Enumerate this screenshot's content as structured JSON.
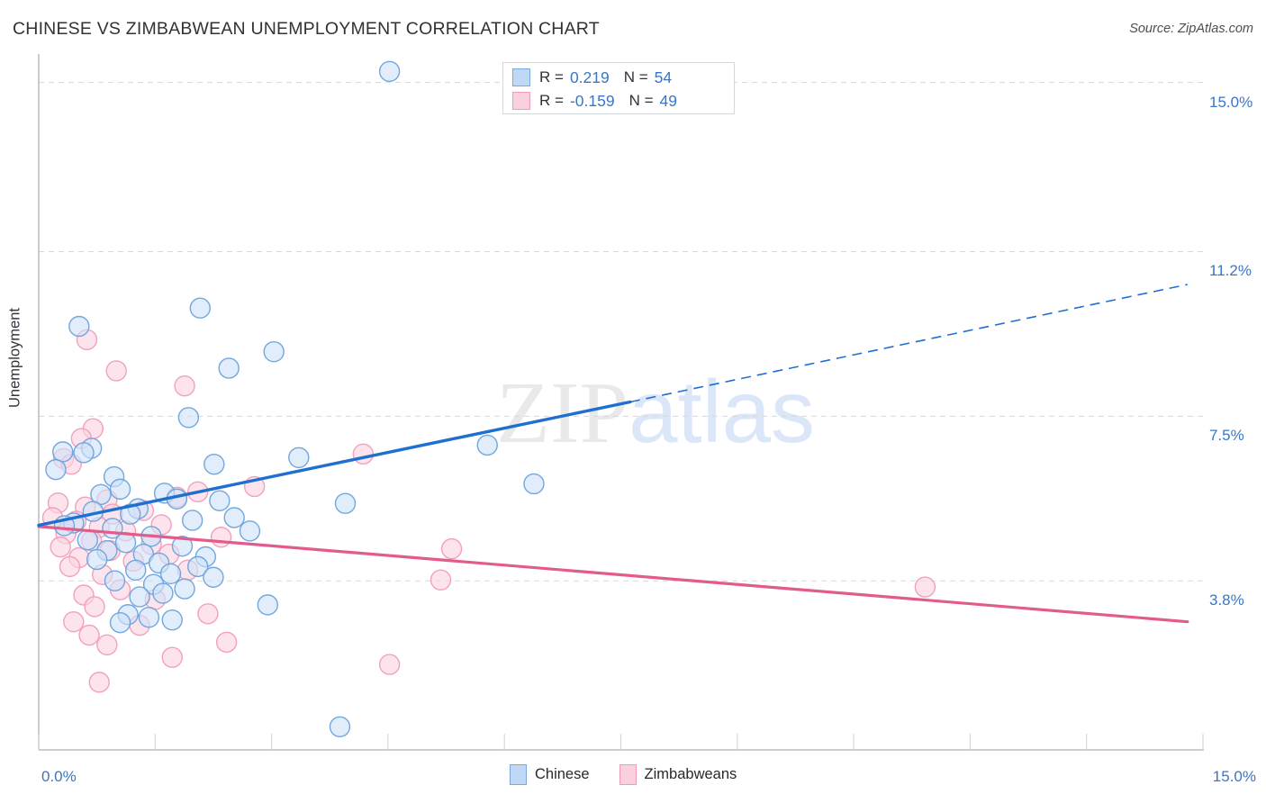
{
  "header": {
    "title": "CHINESE VS ZIMBABWEAN UNEMPLOYMENT CORRELATION CHART",
    "source": "Source: ZipAtlas.com"
  },
  "watermark": {
    "part1": "ZIP",
    "part2": "atlas"
  },
  "stats": {
    "series1": {
      "r_key": "R =",
      "r_value": "0.219",
      "n_key": "N =",
      "n_value": "54"
    },
    "series2": {
      "r_key": "R =",
      "r_value": "-0.159",
      "n_key": "N =",
      "n_value": "49"
    }
  },
  "legend": {
    "items": [
      {
        "label": "Chinese",
        "color": "#bed8f5"
      },
      {
        "label": "Zimbabweans",
        "color": "#fbd0de"
      }
    ]
  },
  "colors": {
    "blue_fill": "#cfe2f8",
    "blue_stroke": "#6aa2db",
    "pink_fill": "#fbd4e1",
    "pink_stroke": "#f09cba",
    "blue_line": "#1f6fd0",
    "pink_line": "#e35a8c",
    "tick_text": "#3a76c4",
    "grid": "#d8d8d8"
  },
  "chart_data": {
    "type": "scatter",
    "title": "CHINESE VS ZIMBABWEAN UNEMPLOYMENT CORRELATION CHART",
    "xlabel": "",
    "ylabel": "Unemployment",
    "xlim": [
      0.0,
      15.0
    ],
    "ylim": [
      0.0,
      15.6
    ],
    "grid": true,
    "legend_position": "bottom-center",
    "xticks": [
      "0.0%",
      "15.0%"
    ],
    "xtick_values": [
      0.0,
      15.0
    ],
    "yticks": [
      "3.8%",
      "7.5%",
      "11.2%",
      "15.0%"
    ],
    "ytick_values": [
      3.8,
      7.5,
      11.2,
      15.0
    ],
    "annotations": [
      {
        "series": "Chinese",
        "R": 0.219,
        "N": 54
      },
      {
        "series": "Zimbabweans",
        "R": -0.159,
        "N": 49
      }
    ],
    "series": [
      {
        "name": "Chinese",
        "color": "#cfe2f8",
        "stroke": "#6aa2db",
        "R": 0.219,
        "N": 54,
        "trendline": {
          "x0": 0.0,
          "y0": 5.05,
          "x1": 7.62,
          "y1": 7.82,
          "x2": 14.8,
          "y2": 10.46,
          "solid_to_x": 7.62,
          "dashed_from_x": 7.62
        },
        "points": [
          [
            4.52,
            15.25
          ],
          [
            2.08,
            9.93
          ],
          [
            0.52,
            9.52
          ],
          [
            3.03,
            8.95
          ],
          [
            2.45,
            8.58
          ],
          [
            1.93,
            7.47
          ],
          [
            0.68,
            6.78
          ],
          [
            0.31,
            6.7
          ],
          [
            0.58,
            6.68
          ],
          [
            5.78,
            6.85
          ],
          [
            3.35,
            6.57
          ],
          [
            2.26,
            6.42
          ],
          [
            0.22,
            6.3
          ],
          [
            0.97,
            6.14
          ],
          [
            6.38,
            5.98
          ],
          [
            1.05,
            5.86
          ],
          [
            1.62,
            5.77
          ],
          [
            0.8,
            5.74
          ],
          [
            1.78,
            5.64
          ],
          [
            2.33,
            5.6
          ],
          [
            3.95,
            5.54
          ],
          [
            1.28,
            5.42
          ],
          [
            0.7,
            5.36
          ],
          [
            1.18,
            5.3
          ],
          [
            2.52,
            5.22
          ],
          [
            1.98,
            5.16
          ],
          [
            0.45,
            5.1
          ],
          [
            0.33,
            5.04
          ],
          [
            0.95,
            4.98
          ],
          [
            2.72,
            4.92
          ],
          [
            1.45,
            4.8
          ],
          [
            0.63,
            4.72
          ],
          [
            1.12,
            4.66
          ],
          [
            1.85,
            4.58
          ],
          [
            0.88,
            4.48
          ],
          [
            1.35,
            4.4
          ],
          [
            2.15,
            4.34
          ],
          [
            0.75,
            4.28
          ],
          [
            1.55,
            4.2
          ],
          [
            2.05,
            4.12
          ],
          [
            1.25,
            4.04
          ],
          [
            1.7,
            3.96
          ],
          [
            2.25,
            3.88
          ],
          [
            0.98,
            3.8
          ],
          [
            1.48,
            3.72
          ],
          [
            1.88,
            3.62
          ],
          [
            1.6,
            3.52
          ],
          [
            1.3,
            3.44
          ],
          [
            2.95,
            3.26
          ],
          [
            1.15,
            3.04
          ],
          [
            1.42,
            2.98
          ],
          [
            1.72,
            2.92
          ],
          [
            1.05,
            2.86
          ],
          [
            3.88,
            0.52
          ]
        ]
      },
      {
        "name": "Zimbabweans",
        "color": "#fbd4e1",
        "stroke": "#f09cba",
        "R": -0.159,
        "N": 49,
        "trendline": {
          "x0": 0.0,
          "y0": 5.02,
          "x1": 14.8,
          "y1": 2.88
        },
        "points": [
          [
            0.62,
            9.22
          ],
          [
            1.0,
            8.52
          ],
          [
            1.88,
            8.18
          ],
          [
            0.7,
            7.22
          ],
          [
            0.55,
            7.0
          ],
          [
            4.18,
            6.65
          ],
          [
            0.32,
            6.55
          ],
          [
            0.42,
            6.42
          ],
          [
            2.78,
            5.92
          ],
          [
            2.05,
            5.8
          ],
          [
            1.78,
            5.68
          ],
          [
            0.88,
            5.62
          ],
          [
            0.25,
            5.55
          ],
          [
            0.6,
            5.46
          ],
          [
            1.35,
            5.38
          ],
          [
            0.95,
            5.3
          ],
          [
            0.18,
            5.22
          ],
          [
            0.48,
            5.14
          ],
          [
            1.58,
            5.06
          ],
          [
            0.78,
            5.0
          ],
          [
            1.12,
            4.92
          ],
          [
            0.35,
            4.86
          ],
          [
            2.35,
            4.78
          ],
          [
            0.68,
            4.7
          ],
          [
            1.45,
            4.62
          ],
          [
            0.28,
            4.56
          ],
          [
            0.92,
            4.48
          ],
          [
            1.68,
            4.4
          ],
          [
            0.52,
            4.32
          ],
          [
            1.22,
            4.24
          ],
          [
            5.32,
            4.52
          ],
          [
            0.4,
            4.12
          ],
          [
            1.92,
            4.04
          ],
          [
            0.82,
            3.94
          ],
          [
            5.18,
            3.82
          ],
          [
            11.42,
            3.66
          ],
          [
            1.05,
            3.6
          ],
          [
            0.58,
            3.48
          ],
          [
            1.5,
            3.38
          ],
          [
            0.72,
            3.22
          ],
          [
            2.18,
            3.06
          ],
          [
            0.45,
            2.88
          ],
          [
            1.3,
            2.8
          ],
          [
            0.65,
            2.58
          ],
          [
            2.42,
            2.42
          ],
          [
            0.88,
            2.36
          ],
          [
            1.72,
            2.08
          ],
          [
            4.52,
            1.92
          ],
          [
            0.78,
            1.52
          ]
        ]
      }
    ]
  }
}
